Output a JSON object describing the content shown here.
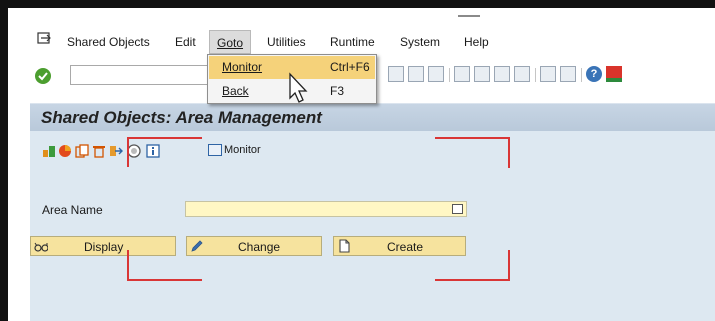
{
  "menubar": {
    "items": [
      {
        "label": "Shared Objects"
      },
      {
        "label": "Edit"
      },
      {
        "label": "Goto"
      },
      {
        "label": "Utilities"
      },
      {
        "label": "Runtime"
      },
      {
        "label": "System"
      },
      {
        "label": "Help"
      }
    ]
  },
  "toolbar": {
    "command_field_value": "",
    "help_glyph": "?"
  },
  "dropdown": {
    "items": [
      {
        "label": "Monitor",
        "shortcut": "Ctrl+F6"
      },
      {
        "label": "Back",
        "shortcut": "F3"
      }
    ],
    "highlight_color": "#f5d27a"
  },
  "page": {
    "title": "Shared Objects: Area Management"
  },
  "app_toolbar": {
    "monitor_label": "Monitor"
  },
  "form": {
    "area_name_label": "Area Name",
    "area_name_value": ""
  },
  "buttons": {
    "display": "Display",
    "change": "Change",
    "create": "Create"
  },
  "colors": {
    "title_bar": "#c7d5e4",
    "content_bg": "#dde8f1",
    "input_bg": "#fff7c4",
    "button_bg": "#f6e39e",
    "annotation": "#d93636",
    "ok_green": "#4c9e2f"
  }
}
